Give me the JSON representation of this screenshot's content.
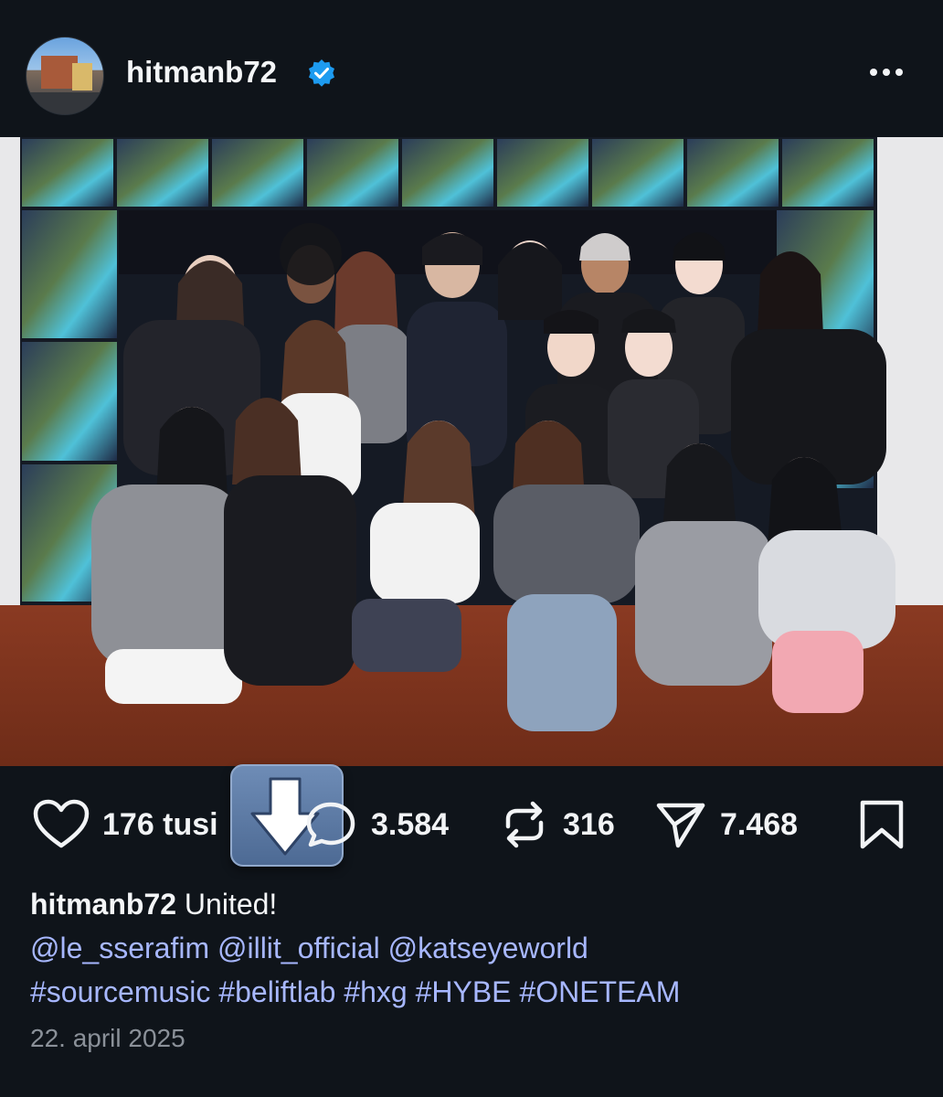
{
  "post": {
    "username": "hitmanb72",
    "caption_text": "United!",
    "mentions": [
      "@le_sserafim",
      "@illit_official",
      "@katseyeworld"
    ],
    "hashtags": [
      "#sourcemusic",
      "#beliftlab",
      "#hxg",
      "#HYBE",
      "#ONETEAM"
    ],
    "date": "22. april 2025"
  },
  "actions": {
    "likes": "176 tusi",
    "comments": "3.584",
    "reposts": "316",
    "shares": "7.468"
  },
  "colors": {
    "background": "#0f141a",
    "link": "#a7b7ff",
    "verified": "#1d9bf0"
  },
  "icons": [
    "verified-badge-icon",
    "more-options-icon",
    "heart-icon",
    "comment-icon",
    "repost-icon",
    "share-icon",
    "bookmark-icon",
    "download-arrow-icon"
  ]
}
